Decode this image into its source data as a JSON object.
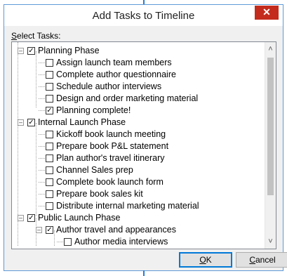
{
  "dialog": {
    "title": "Add Tasks to Timeline",
    "close_glyph": "✕",
    "select_label_access": "S",
    "select_label_rest": "elect Tasks:",
    "ok_access": "O",
    "ok_rest": "K",
    "cancel_access": "C",
    "cancel_rest": "ancel"
  },
  "icons": {
    "collapse": "–",
    "check": "✓",
    "scroll_up": "˄",
    "scroll_down": "˅"
  },
  "tree": [
    {
      "label": "Planning Phase",
      "level": 0,
      "checked": true,
      "expandable": true
    },
    {
      "label": "Assign launch team members",
      "level": 1,
      "checked": false
    },
    {
      "label": "Complete author questionnaire",
      "level": 1,
      "checked": false
    },
    {
      "label": "Schedule author interviews",
      "level": 1,
      "checked": false
    },
    {
      "label": "Design and order marketing material",
      "level": 1,
      "checked": false
    },
    {
      "label": "Planning complete!",
      "level": 1,
      "checked": true
    },
    {
      "label": "Internal Launch Phase",
      "level": 0,
      "checked": true,
      "expandable": true
    },
    {
      "label": "Kickoff book launch meeting",
      "level": 1,
      "checked": false
    },
    {
      "label": "Prepare book P&L statement",
      "level": 1,
      "checked": false
    },
    {
      "label": "Plan author's travel itinerary",
      "level": 1,
      "checked": false
    },
    {
      "label": "Channel Sales prep",
      "level": 1,
      "checked": false
    },
    {
      "label": "Complete book launch form",
      "level": 1,
      "checked": false
    },
    {
      "label": "Prepare book sales kit",
      "level": 1,
      "checked": false
    },
    {
      "label": "Distribute internal marketing material",
      "level": 1,
      "checked": false
    },
    {
      "label": "Public Launch Phase",
      "level": 0,
      "checked": true,
      "expandable": true
    },
    {
      "label": "Author travel and appearances",
      "level": 1,
      "checked": true,
      "expandable": true
    },
    {
      "label": "Author media interviews",
      "level": 2,
      "checked": false
    }
  ]
}
